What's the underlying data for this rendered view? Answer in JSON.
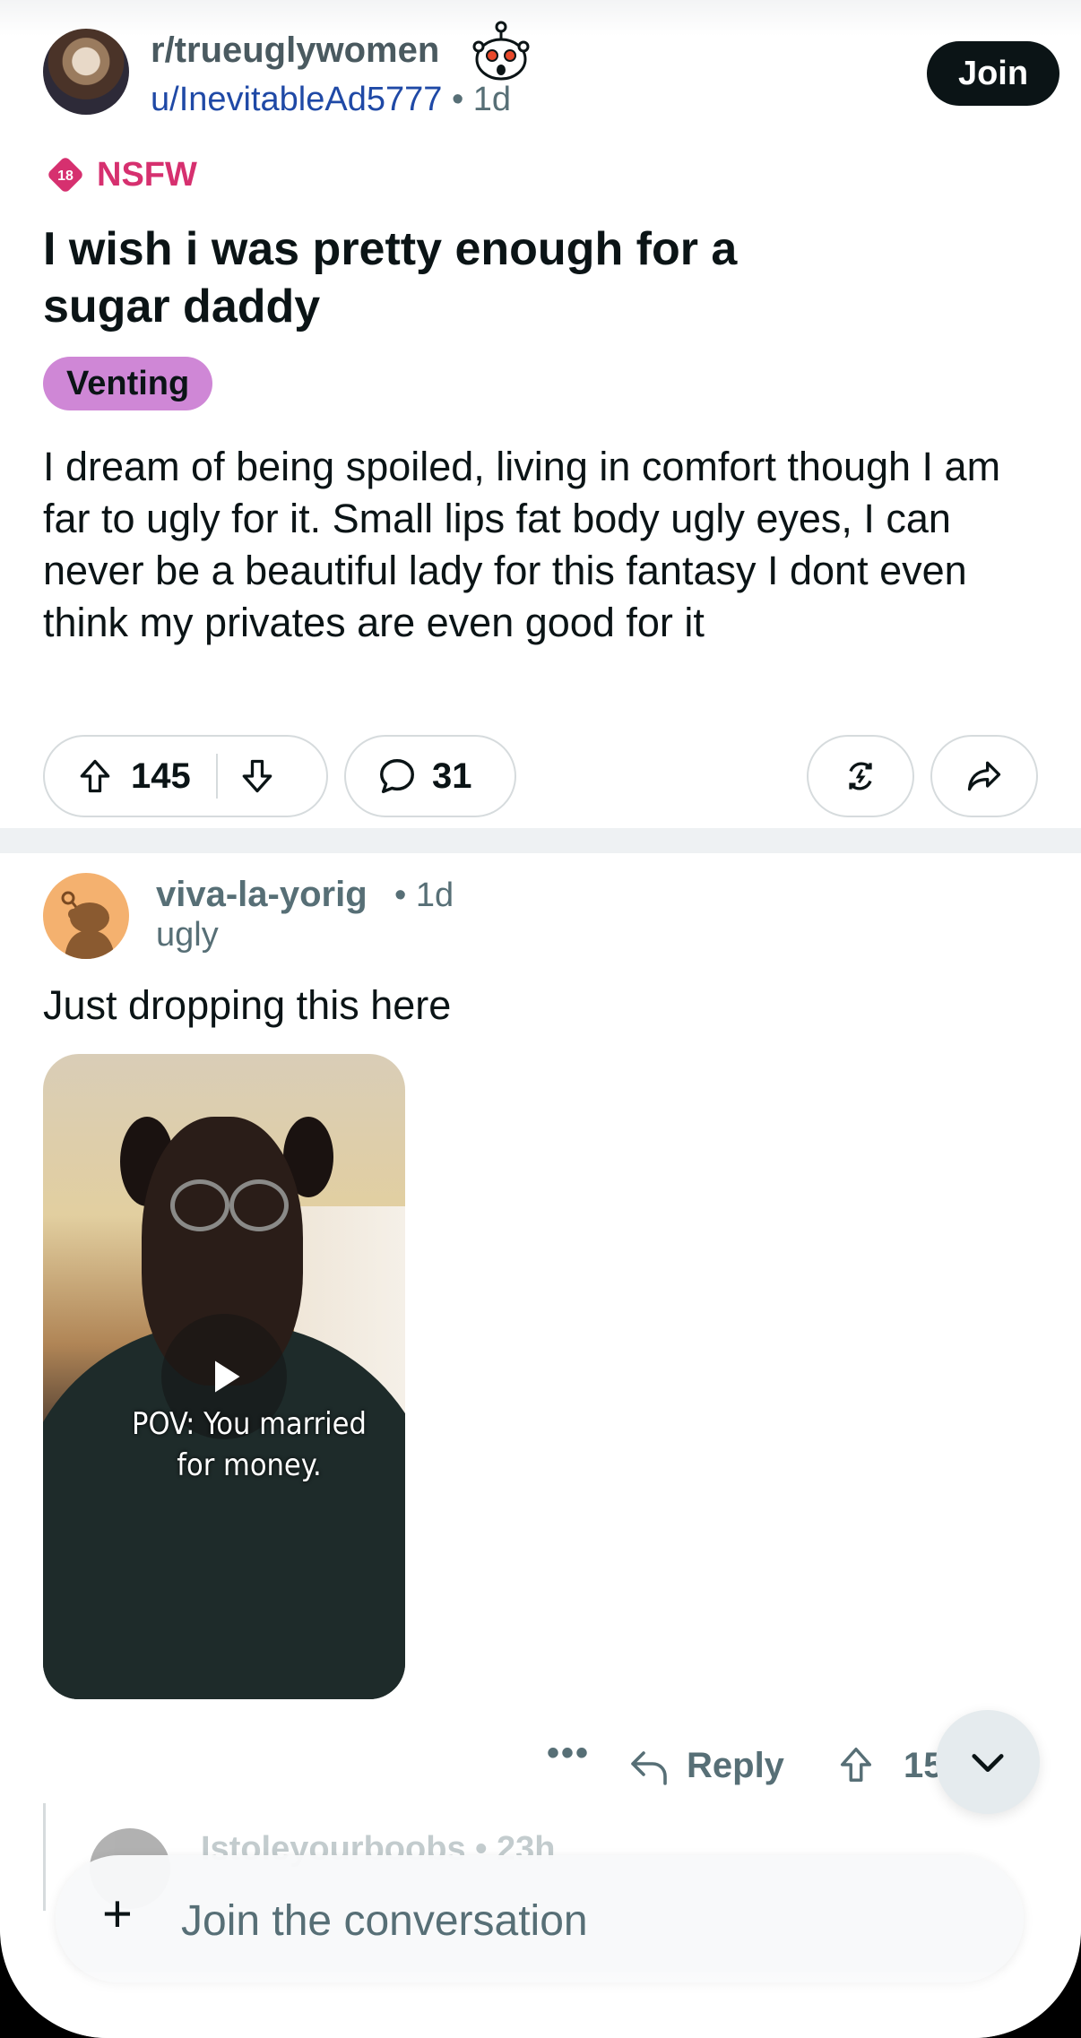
{
  "post": {
    "subreddit": "r/trueuglywomen",
    "author": "u/InevitableAd5777",
    "age": "• 1d",
    "join_label": "Join",
    "nsfw_badge_number": "18",
    "nsfw_label": "NSFW",
    "title": "I wish i was pretty enough for a sugar daddy",
    "flair": "Venting",
    "body": "I dream of being spoiled, living in comfort though I am far to ugly for it. Small lips fat body ugly eyes, I can never be a beautiful lady for this fantasy I dont even think my privates are even good for it",
    "upvotes": "145",
    "comments": "31"
  },
  "comment": {
    "author": "viva-la-yorig",
    "age": "• 1d",
    "user_flair": "ugly",
    "text": "Just dropping this here",
    "video_caption_line1": "POV: You married",
    "video_caption_line2": "for money.",
    "more_label": "•••",
    "reply_label": "Reply",
    "upvotes_partial": "15"
  },
  "reply_peek": {
    "author": "Istoleyourboobs • 23h"
  },
  "composer": {
    "plus": "+",
    "placeholder": "Join the conversation"
  },
  "colors": {
    "join_bg": "#0b1416",
    "nsfw": "#d6306f",
    "flair_bg": "#cf87d6",
    "author_link": "#1f49a6",
    "meta": "#576f76"
  },
  "icons": [
    "snoo-shocked-icon",
    "nsfw-diamond-icon",
    "upvote-icon",
    "downvote-icon",
    "comment-icon",
    "award-icon",
    "share-icon",
    "reply-icon",
    "chevron-down-icon",
    "play-icon",
    "plus-icon"
  ]
}
